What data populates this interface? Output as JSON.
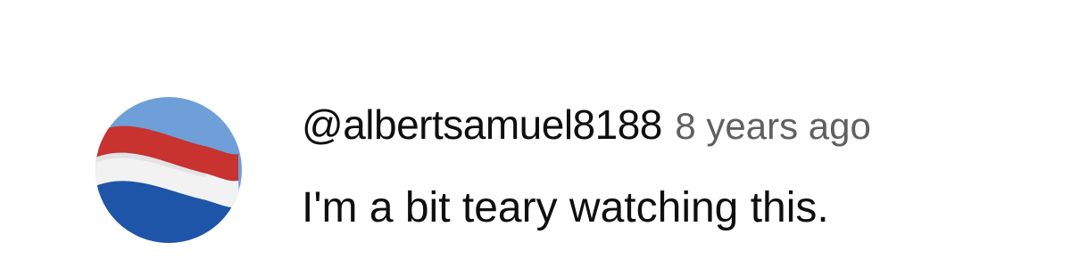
{
  "comment": {
    "author": "@albertsamuel8188",
    "time": "8 years ago",
    "text": "I'm a bit teary watching this."
  },
  "avatar": {
    "icon": "netherlands-flag-icon",
    "colors": {
      "sky": "#6f9fd8",
      "red": "#c8322f",
      "white": "#f2f2f2",
      "blue": "#1f55a8"
    }
  }
}
